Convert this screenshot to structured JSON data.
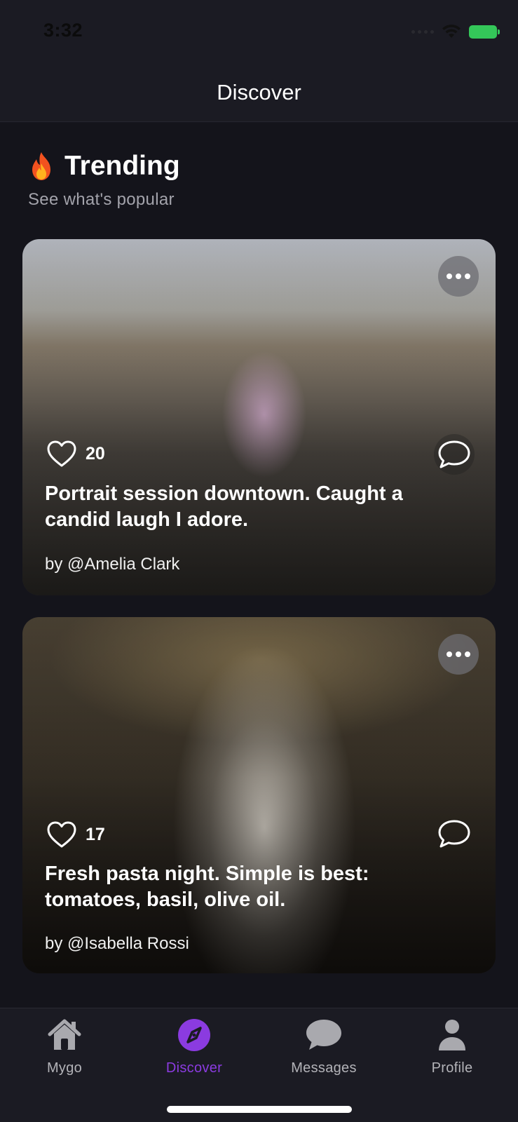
{
  "status_bar": {
    "time": "3:32"
  },
  "nav": {
    "title": "Discover"
  },
  "section": {
    "title": "Trending",
    "subtitle": "See what's popular"
  },
  "posts": [
    {
      "likes": "20",
      "caption": "Portrait session downtown. Caught a candid laugh I adore.",
      "author": "by @Amelia Clark"
    },
    {
      "likes": "17",
      "caption": "Fresh pasta night. Simple is best: tomatoes, basil, olive oil.",
      "author": "by @Isabella Rossi"
    }
  ],
  "tabs": [
    {
      "label": "Mygo",
      "icon": "house-icon",
      "active": false
    },
    {
      "label": "Discover",
      "icon": "compass-icon",
      "active": true
    },
    {
      "label": "Messages",
      "icon": "chat-bubble-icon",
      "active": false
    },
    {
      "label": "Profile",
      "icon": "person-icon",
      "active": false
    }
  ],
  "colors": {
    "accent": "#8b3be0",
    "background": "#14141b",
    "bar": "#1b1b23",
    "battery": "#34c759"
  }
}
